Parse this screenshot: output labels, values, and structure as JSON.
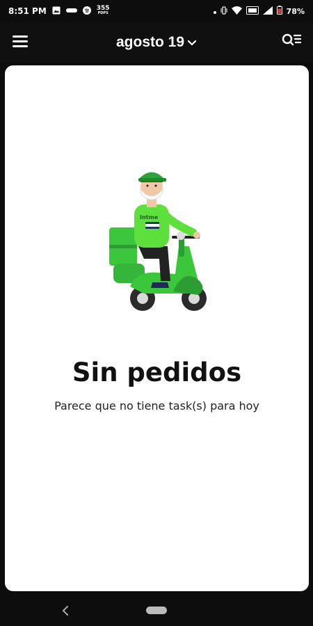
{
  "status_bar": {
    "time": "8:51 PM",
    "badge_top": "355",
    "badge_bottom": "PDPS",
    "battery": "78%",
    "icons": [
      "image-icon",
      "notification-icon",
      "spotify-icon",
      "vibrate-icon",
      "wifi-icon",
      "volte-icon",
      "signal-icon",
      "battery-icon"
    ]
  },
  "header": {
    "title": "agosto 19",
    "menu_icon": "hamburger-icon",
    "right_icon": "search-list-icon"
  },
  "empty_state": {
    "title": "Sin pedidos",
    "subtitle": "Parece que no tiene task(s) para hoy",
    "shirt_text": "Intme"
  },
  "colors": {
    "background": "#0d0d0d",
    "card": "#ffffff",
    "accent_green": "#3cc63c",
    "dark_green": "#1f8a2a"
  }
}
